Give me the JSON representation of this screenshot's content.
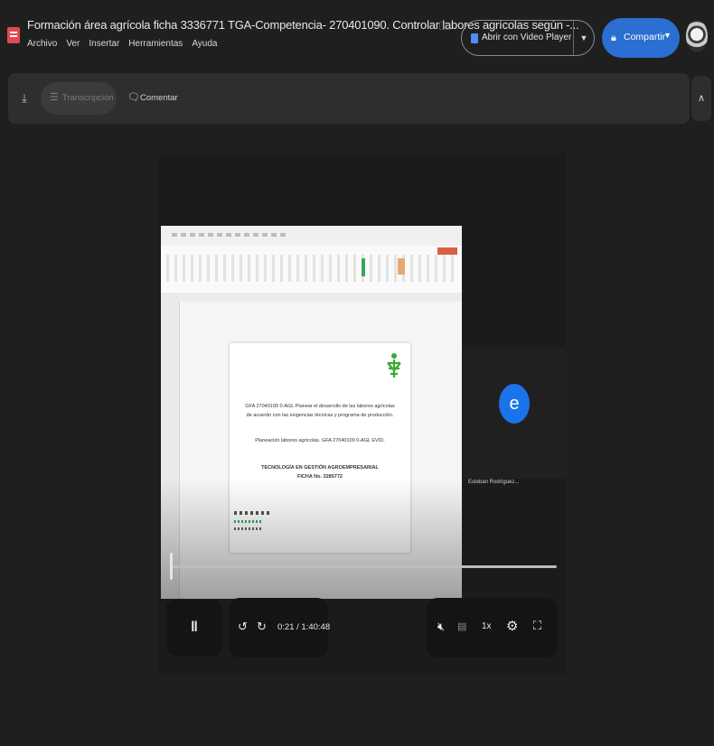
{
  "header": {
    "doc_title": "Formación área agrícola ficha 3336771 TGA-Competencia- 270401090. Controlar labores agrícolas según -...",
    "menu": [
      "Archivo",
      "Ver",
      "Insertar",
      "Herramientas",
      "Ayuda"
    ],
    "open_with_label": "Abrir con Video Player for G...",
    "share_label": "Compartir"
  },
  "toolbar": {
    "transcription_label": "Transcripción",
    "comment_label": "Comentar"
  },
  "slide": {
    "line1": "GFA 27040109 0-AGL Planear el desarrollo de las labores agrícolas",
    "line2": "de acuerdo con las exigencias técnicas y programa de producción.",
    "line3": "Planeación labores agrícolas. GFA 27040109 0-AGL EVID.",
    "line4": "TECNOLOGÍA EN GESTIÓN AGROEMPRESARIAL",
    "line5": "FICHA No. 3285772"
  },
  "participant": {
    "initial": "e",
    "name": "Esteban Rodríguez..."
  },
  "player": {
    "time": "0:21 / 1:40:48",
    "speed": "1x",
    "progress_fraction": 0.003
  },
  "colors": {
    "share_blue": "#2a6fd1",
    "avatar_blue": "#1a73e8",
    "brand_red": "#e04a52"
  }
}
